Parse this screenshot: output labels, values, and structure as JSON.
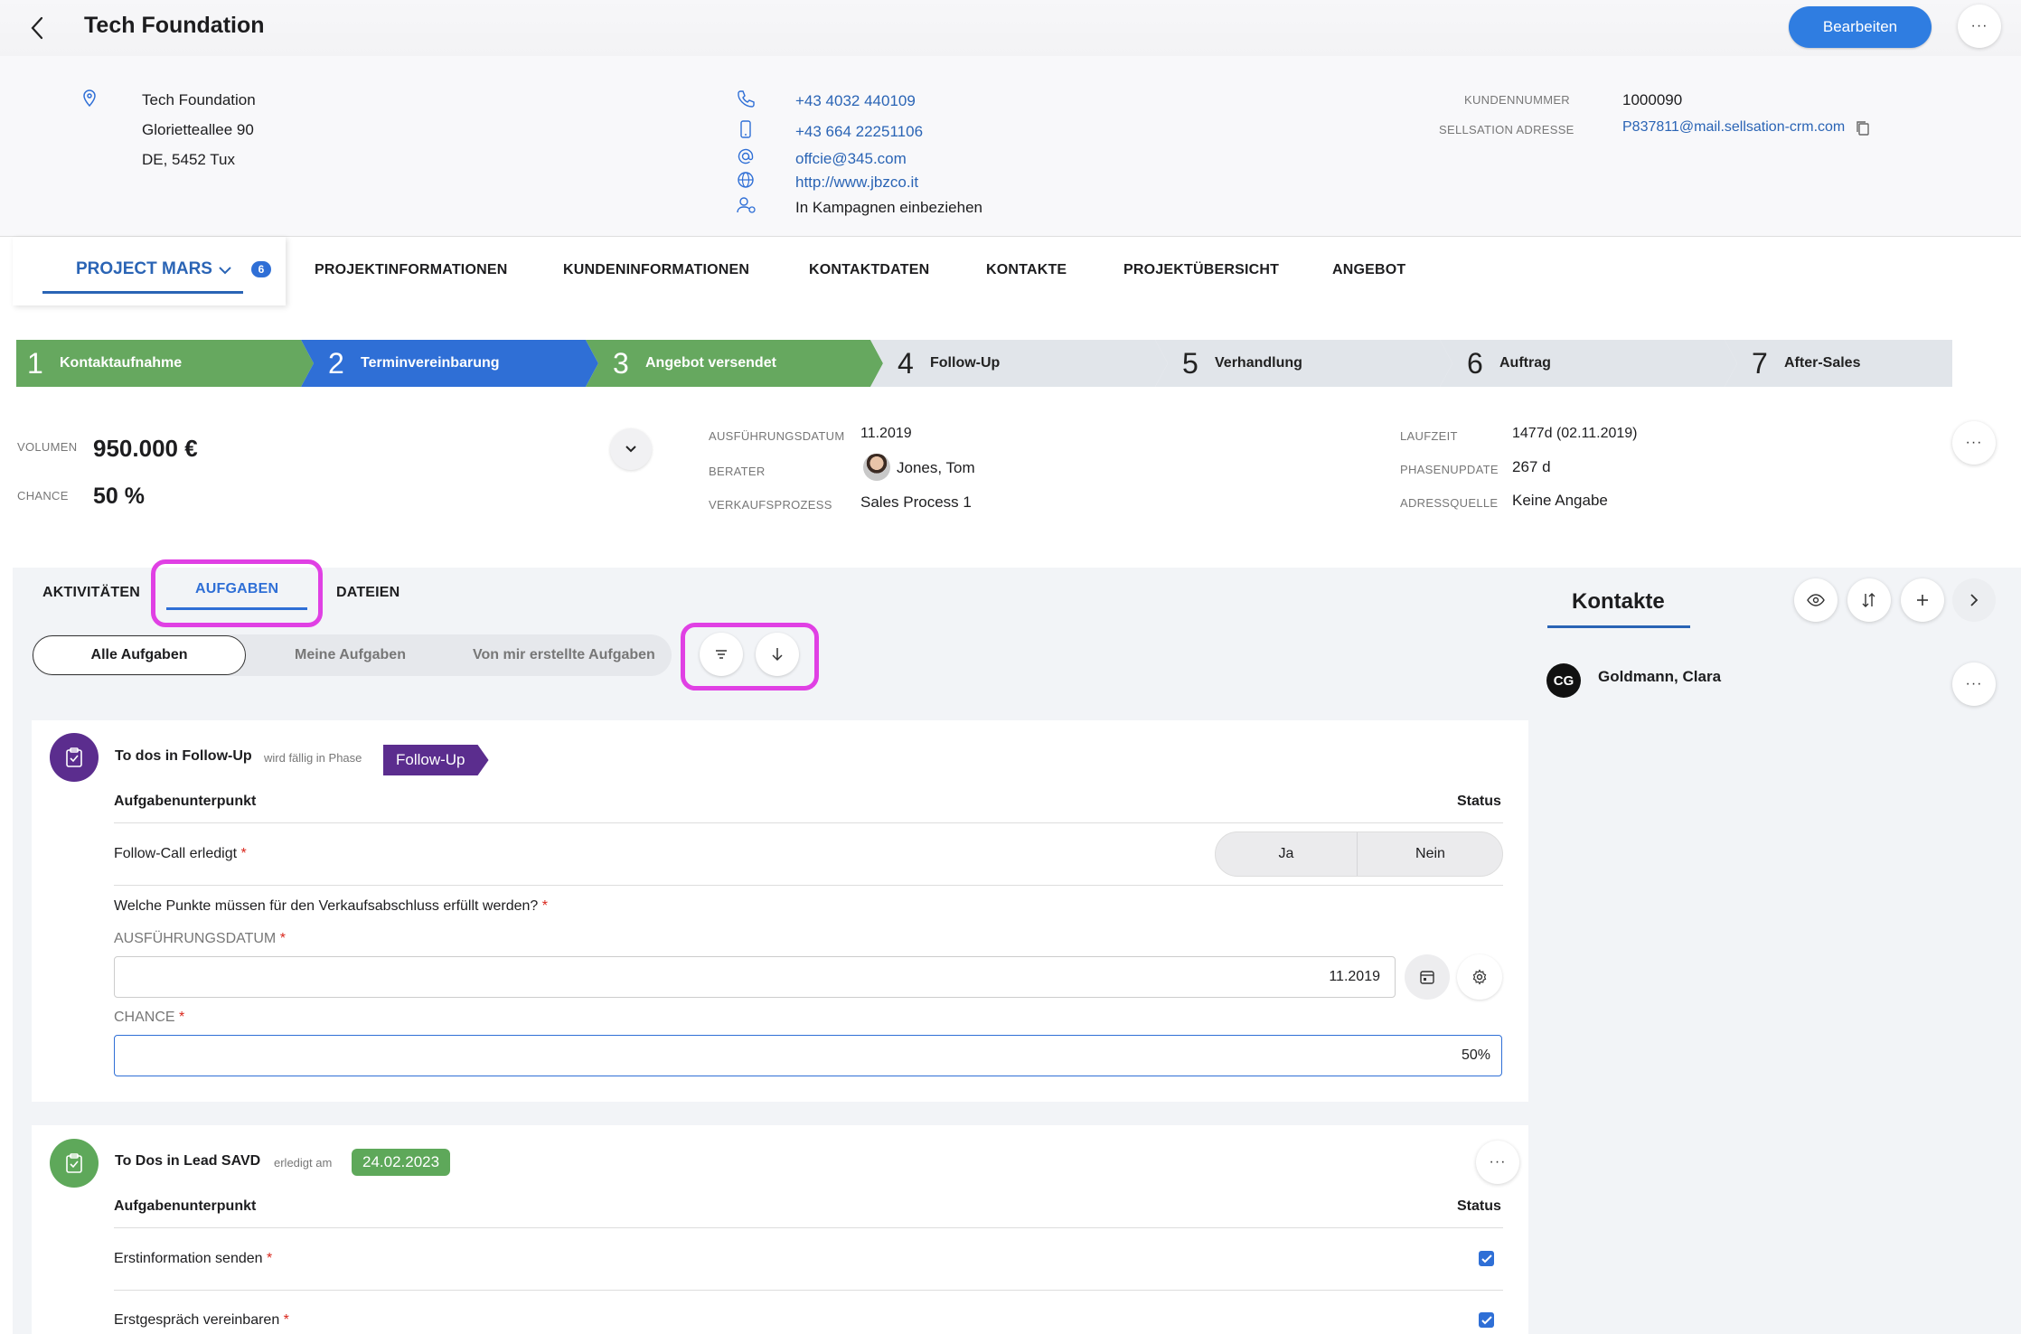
{
  "header": {
    "title": "Tech Foundation",
    "edit_label": "Bearbeiten",
    "more_label": "···"
  },
  "address": {
    "line1": "Tech Foundation",
    "line2": "Glorietteallee 90",
    "line3": "DE, 5452 Tux"
  },
  "contact": {
    "phone": "+43 4032 440109",
    "mobile": "+43 664 22251106",
    "email": "offcie@345.com",
    "web": "http://www.jbzco.it",
    "campaign": "In Kampagnen einbeziehen"
  },
  "customer": {
    "number_label": "KUNDENNUMMER",
    "number": "1000090",
    "sellsation_label": "SELLSATION ADRESSE",
    "sellsation": "P837811@mail.sellsation-crm.com"
  },
  "project": {
    "name": "PROJECT MARS",
    "count": "6",
    "tabs": [
      "PROJEKTINFORMATIONEN",
      "KUNDENINFORMATIONEN",
      "KONTAKTDATEN",
      "KONTAKTE",
      "PROJEKTÜBERSICHT",
      "ANGEBOT"
    ]
  },
  "pipeline": [
    {
      "num": "1",
      "label": "Kontaktaufnahme",
      "state": "done",
      "color": "#66a85f"
    },
    {
      "num": "2",
      "label": "Terminvereinbarung",
      "state": "current",
      "color": "#2f6fd6"
    },
    {
      "num": "3",
      "label": "Angebot versendet",
      "state": "done",
      "color": "#66a85f"
    },
    {
      "num": "4",
      "label": "Follow-Up",
      "state": "todo",
      "color": "#e1e5ea"
    },
    {
      "num": "5",
      "label": "Verhandlung",
      "state": "todo",
      "color": "#e1e5ea"
    },
    {
      "num": "6",
      "label": "Auftrag",
      "state": "todo",
      "color": "#e1e5ea"
    },
    {
      "num": "7",
      "label": "After-Sales",
      "state": "todo",
      "color": "#e1e5ea"
    }
  ],
  "metrics": {
    "volume_label": "VOLUMEN",
    "volume": "950.000 €",
    "chance_label": "CHANCE",
    "chance": "50 %"
  },
  "details": {
    "exec_label": "AUSFÜHRUNGSDATUM",
    "exec": "11.2019",
    "advisor_label": "BERATER",
    "advisor": "Jones, Tom",
    "process_label": "VERKAUFSPROZESS",
    "process": "Sales Process 1",
    "runtime_label": "LAUFZEIT",
    "runtime": "1477d (02.11.2019)",
    "phase_label": "PHASENUPDATE",
    "phase": "267 d",
    "source_label": "ADRESSQUELLE",
    "source": "Keine Angabe"
  },
  "subtabs": {
    "activities": "AKTIVITÄTEN",
    "tasks": "AUFGABEN",
    "files": "DATEIEN"
  },
  "filters": {
    "all": "Alle Aufgaben",
    "mine": "Meine Aufgaben",
    "created": "Von mir erstellte Aufgaben"
  },
  "card1": {
    "title": "To dos in Follow-Up",
    "due_text": "wird fällig in Phase",
    "phase_tag": "Follow-Up",
    "tag_color": "#5b2d8e",
    "col_item": "Aufgabenunterpunkt",
    "col_status": "Status",
    "row1": "Follow-Call erledigt",
    "yes": "Ja",
    "no": "Nein",
    "question": "Welche Punkte müssen für den Verkaufsabschluss erfüllt werden?",
    "date_label": "AUSFÜHRUNGSDATUM",
    "date_value": "11.2019",
    "chance_label": "CHANCE",
    "chance_value": "50%"
  },
  "card2": {
    "title": "To Dos in Lead SAVD",
    "done_text": "erledigt am",
    "done_date": "24.02.2023",
    "tag_color": "#5ea85a",
    "col_item": "Aufgabenunterpunkt",
    "col_status": "Status",
    "row1": "Erstinformation senden",
    "row2": "Erstgespräch vereinbaren"
  },
  "contacts": {
    "title": "Kontakte",
    "person": {
      "initials": "CG",
      "name": "Goldmann, Clara"
    }
  },
  "required_mark": "*"
}
